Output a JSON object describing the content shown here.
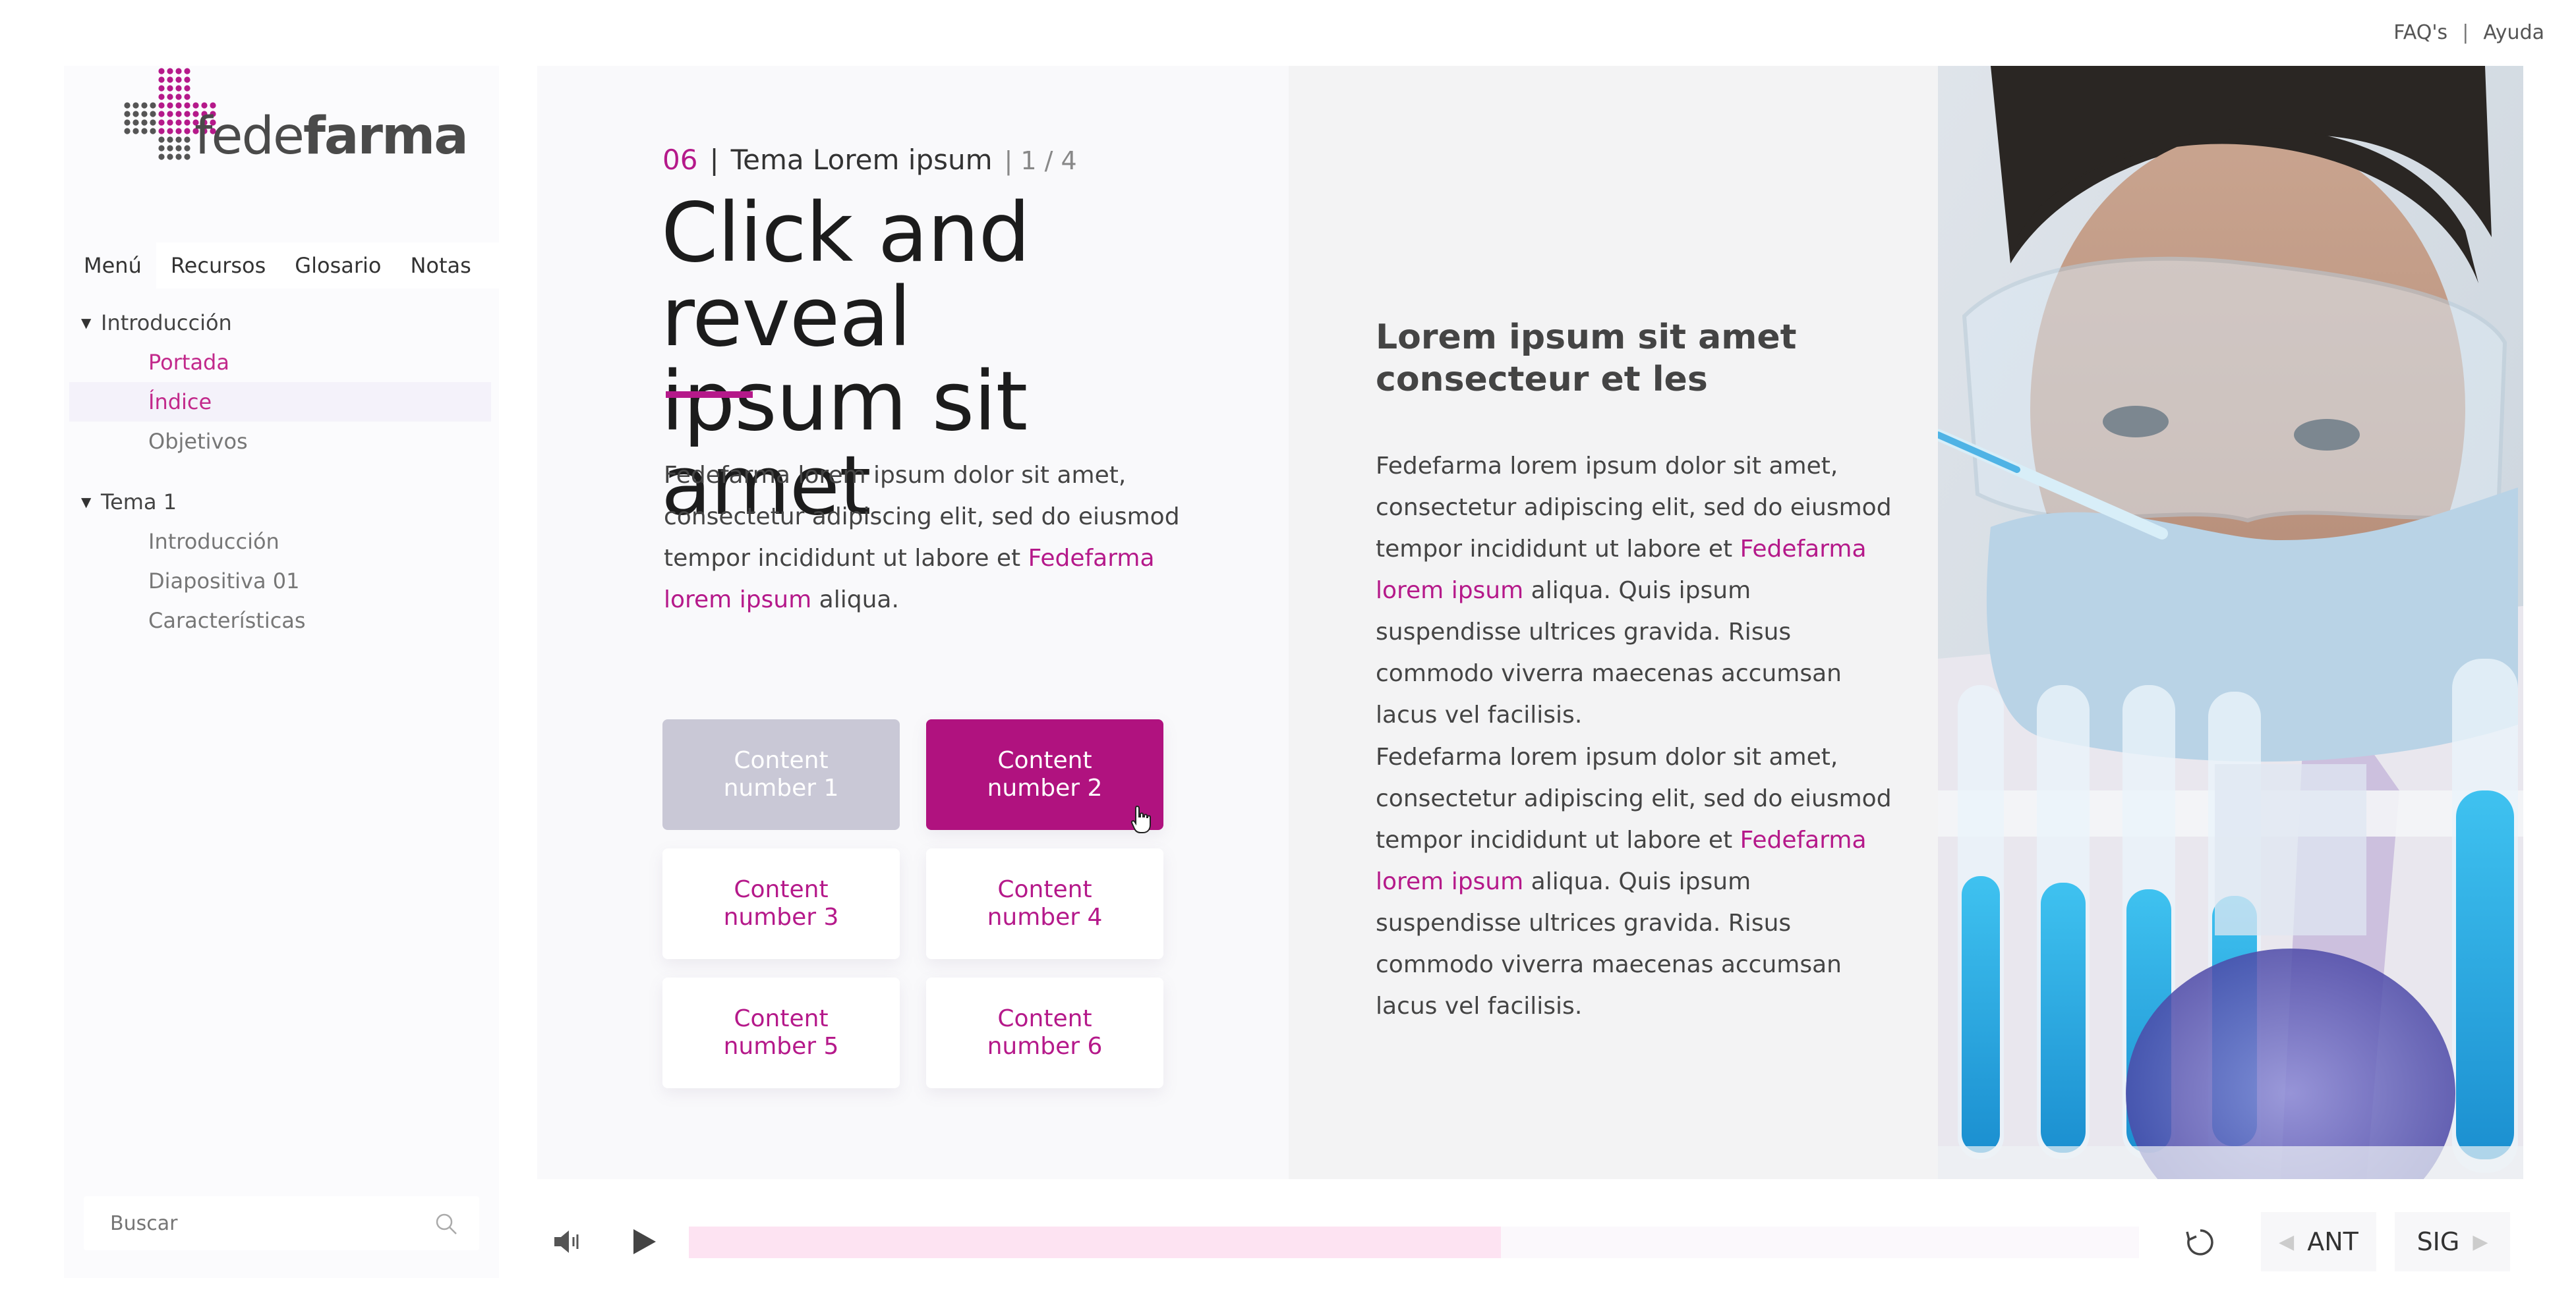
{
  "top_links": {
    "faqs": "FAQ's",
    "separator": "|",
    "help": "Ayuda"
  },
  "logo": {
    "brand_light": "fede",
    "brand_bold": "farma"
  },
  "sidebar": {
    "tabs": [
      {
        "label": "Menú",
        "active": true
      },
      {
        "label": "Recursos"
      },
      {
        "label": "Glosario"
      },
      {
        "label": "Notas"
      }
    ],
    "tree": [
      {
        "label": "Introducción",
        "children": [
          {
            "label": "Portada",
            "state": "visited"
          },
          {
            "label": "Índice",
            "state": "selected"
          },
          {
            "label": "Objetivos"
          }
        ]
      },
      {
        "label": "Tema 1",
        "children": [
          {
            "label": "Introducción"
          },
          {
            "label": "Diapositiva 01"
          },
          {
            "label": "Características"
          }
        ]
      }
    ],
    "search_placeholder": "Buscar"
  },
  "content": {
    "topic_number": "06",
    "sep": "|",
    "topic_title": "Tema Lorem ipsum",
    "page_indicator": "| 1 / 4",
    "title_line1": "Click and reveal",
    "title_line2": "ipsum sit amet",
    "intro": {
      "before": "Fedefarma lorem ipsum dolor sit amet, consectetur adipiscing elit, sed do eiusmod tempor incididunt ut labore et ",
      "link": "Fedefarma lorem ipsum",
      "after": " aliqua."
    },
    "cards": [
      {
        "line1": "Content",
        "line2": "number 1",
        "state": "visited"
      },
      {
        "line1": "Content",
        "line2": "number 2",
        "state": "active"
      },
      {
        "line1": "Content",
        "line2": "number 3",
        "state": "default"
      },
      {
        "line1": "Content",
        "line2": "number 4",
        "state": "default"
      },
      {
        "line1": "Content",
        "line2": "number 5",
        "state": "default"
      },
      {
        "line1": "Content",
        "line2": "number 6",
        "state": "default"
      }
    ]
  },
  "reveal_panel": {
    "heading_line1": "Lorem ipsum sit amet",
    "heading_line2": "consecteur et les",
    "paragraphs": [
      {
        "before": "Fedefarma lorem ipsum dolor sit amet, consectetur adipiscing elit, sed do eiusmod tempor incididunt ut labore et ",
        "link": "Fedefarma lorem ipsum",
        "after": " aliqua. Quis ipsum suspendisse ultrices gravida. Risus commodo viverra maecenas accumsan lacus vel facilisis."
      },
      {
        "before": "Fedefarma lorem ipsum dolor sit amet, consectetur adipiscing elit, sed do eiusmod tempor incididunt ut labore et ",
        "link": "Fedefarma lorem ipsum",
        "after": " aliqua. Quis ipsum suspendisse ultrices gravida. Risus commodo viverra maecenas accumsan lacus vel facilisis."
      }
    ]
  },
  "player": {
    "progress": 0.56,
    "prev_label": "ANT",
    "next_label": "SIG"
  },
  "colors": {
    "accent": "#b5198a",
    "accent_dark": "#b0127f",
    "visited_card": "#c9c8d6",
    "progress_fill": "#fde3f2"
  }
}
